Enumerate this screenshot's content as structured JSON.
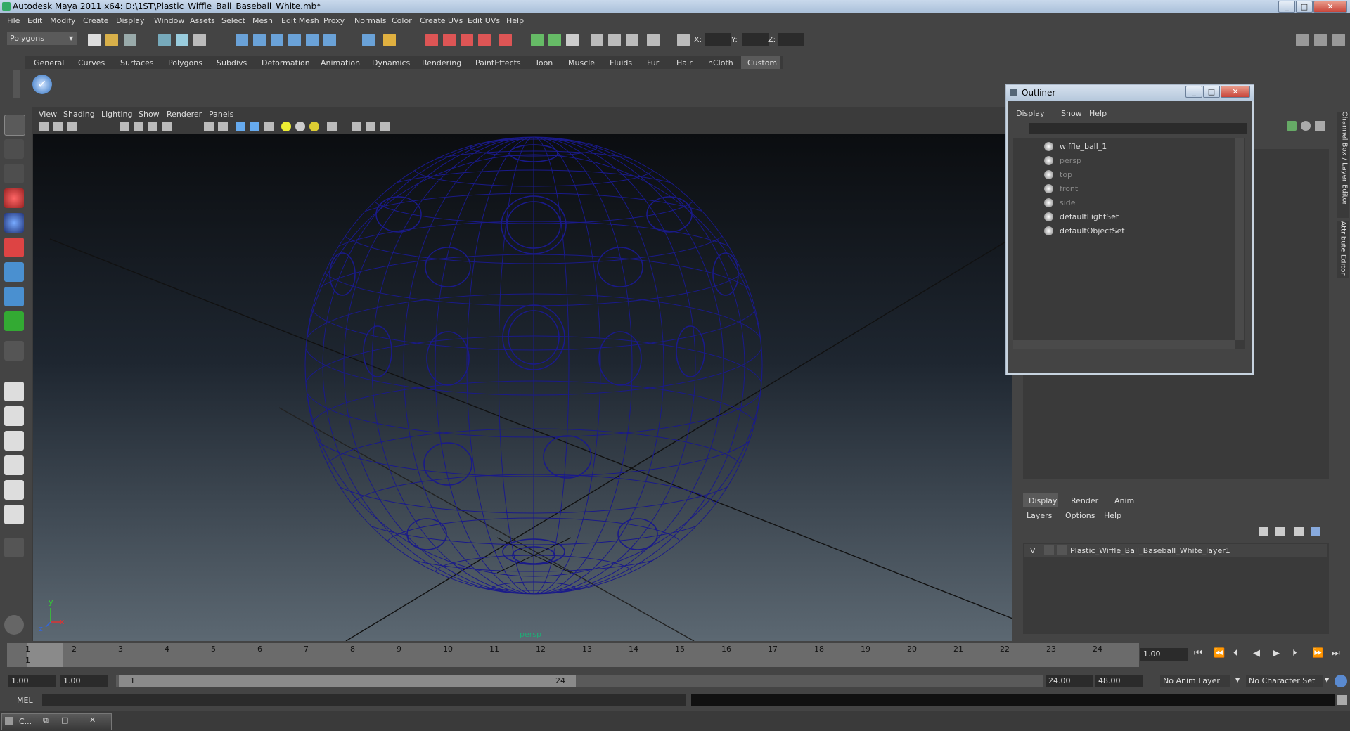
{
  "window": {
    "title": "Autodesk Maya 2011 x64: D:\\1ST\\Plastic_Wiffle_Ball_Baseball_White.mb*"
  },
  "menu": [
    "File",
    "Edit",
    "Modify",
    "Create",
    "Display",
    "Window",
    "Assets",
    "Select",
    "Mesh",
    "Edit Mesh",
    "Proxy",
    "Normals",
    "Color",
    "Create UVs",
    "Edit UVs",
    "Help"
  ],
  "toolbar": {
    "mode": "Polygons",
    "x_label": "X:",
    "y_label": "Y:",
    "z_label": "Z:"
  },
  "shelf_tabs": [
    "General",
    "Curves",
    "Surfaces",
    "Polygons",
    "Subdivs",
    "Deformation",
    "Animation",
    "Dynamics",
    "Rendering",
    "PaintEffects",
    "Toon",
    "Muscle",
    "Fluids",
    "Fur",
    "Hair",
    "nCloth",
    "Custom"
  ],
  "shelf_active": "Custom",
  "viewport": {
    "menu": [
      "View",
      "Shading",
      "Lighting",
      "Show",
      "Renderer",
      "Panels"
    ],
    "camera_label": "persp",
    "axis_y": "y",
    "axis_x": "x",
    "axis_z": "z"
  },
  "outliner": {
    "title": "Outliner",
    "menu": [
      "Display",
      "Show",
      "Help"
    ],
    "items": [
      {
        "label": "wiffle_ball_1",
        "dim": false
      },
      {
        "label": "persp",
        "dim": true
      },
      {
        "label": "top",
        "dim": true
      },
      {
        "label": "front",
        "dim": true
      },
      {
        "label": "side",
        "dim": true
      },
      {
        "label": "defaultLightSet",
        "dim": false
      },
      {
        "label": "defaultObjectSet",
        "dim": false
      }
    ]
  },
  "side_tabs": {
    "channel": "Channel Box / Layer Editor",
    "attribute": "Attribute Editor"
  },
  "layer_editor": {
    "tabs": [
      "Display",
      "Render",
      "Anim"
    ],
    "active_tab": "Display",
    "menu": [
      "Layers",
      "Options",
      "Help"
    ],
    "layer": {
      "visible": "V",
      "name": "Plastic_Wiffle_Ball_Baseball_White_layer1"
    }
  },
  "timeline": {
    "ticks": [
      "1",
      "2",
      "3",
      "4",
      "5",
      "6",
      "7",
      "8",
      "9",
      "10",
      "11",
      "12",
      "13",
      "14",
      "15",
      "16",
      "17",
      "18",
      "19",
      "20",
      "21",
      "22",
      "23",
      "24"
    ],
    "current_frame": "1",
    "current_time": "1.00"
  },
  "range": {
    "start": "1.00",
    "anim_start": "1.00",
    "slider_start": "1",
    "slider_end": "24",
    "end": "24.00",
    "anim_end": "48.00",
    "anim_layer": "No Anim Layer",
    "character_set": "No Character Set"
  },
  "cmdline": {
    "label": "MEL"
  },
  "taskbar": {
    "item": "C..."
  }
}
